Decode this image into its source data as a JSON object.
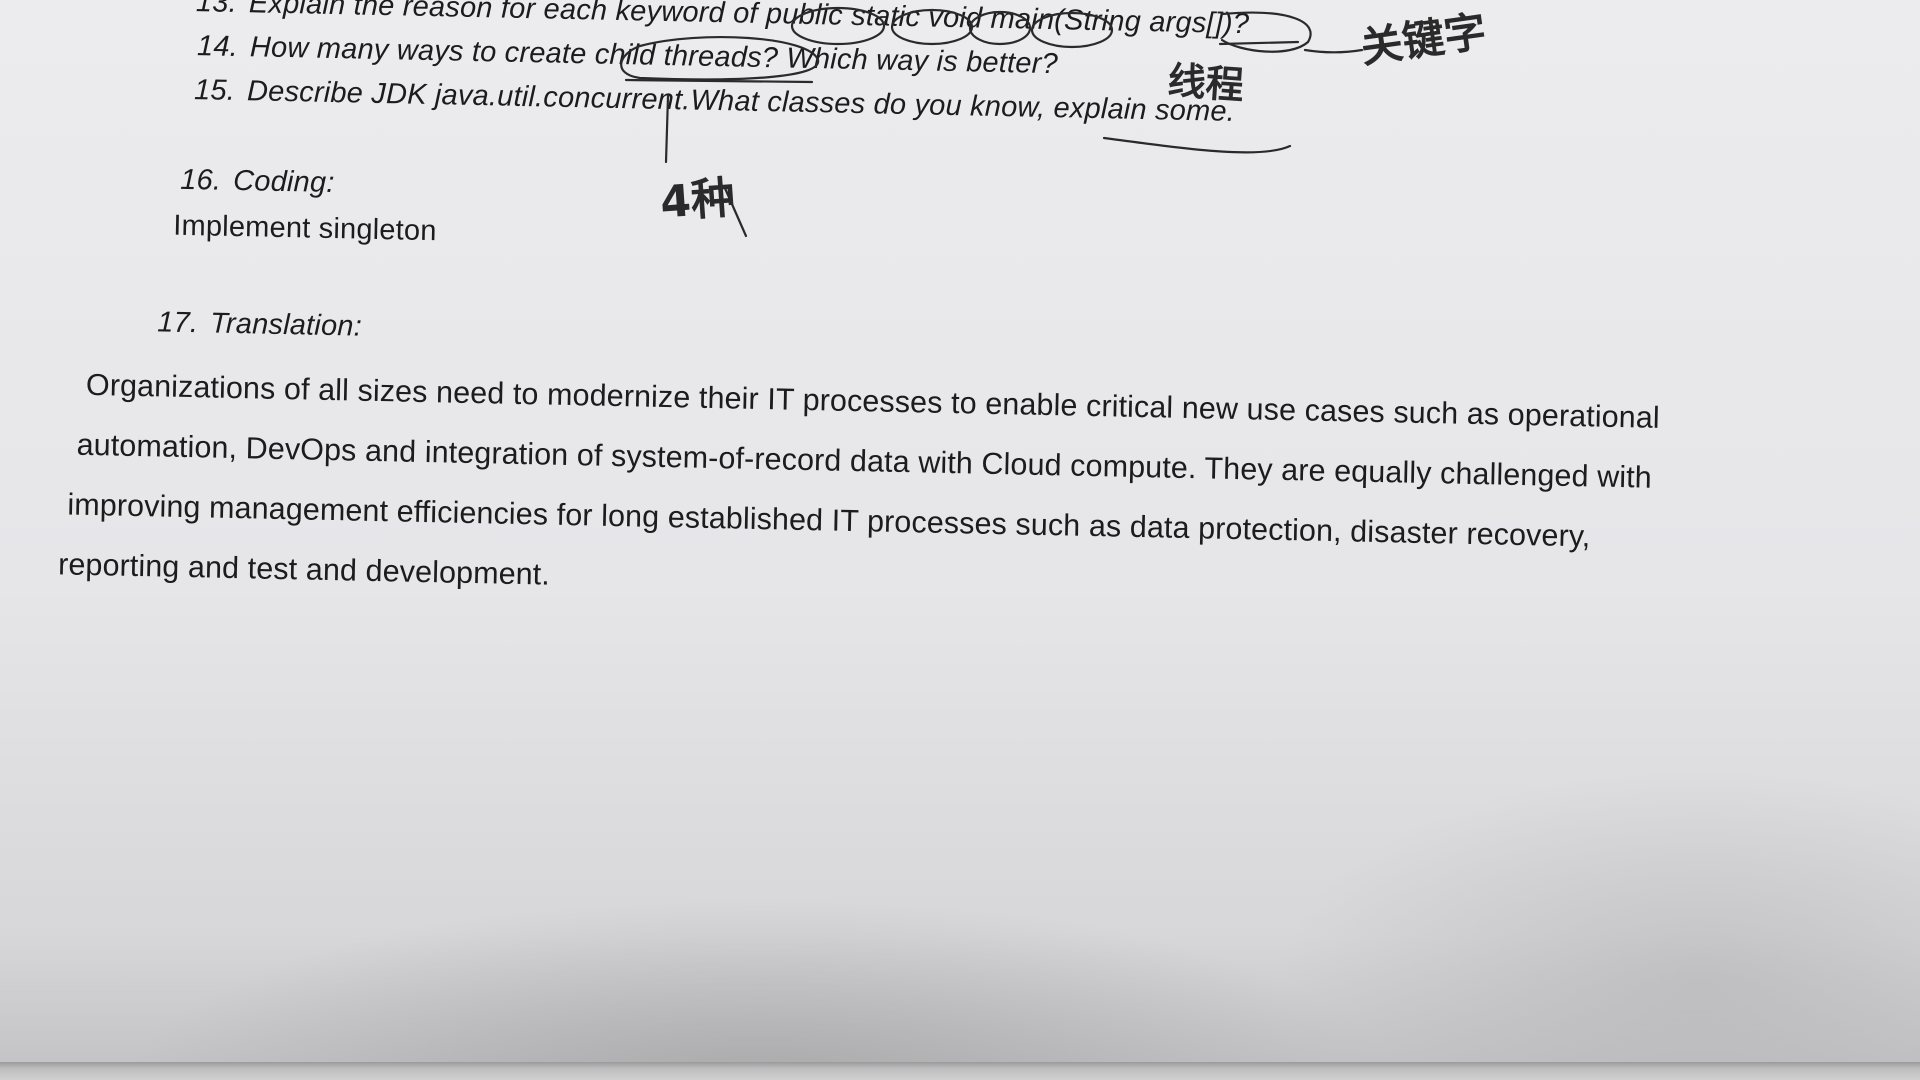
{
  "questions": [
    {
      "number": "13.",
      "text": "Explain the reason for each keyword of public static void main(String args[])?"
    },
    {
      "number": "14.",
      "text": "How many ways to create child threads? Which way is better?"
    },
    {
      "number": "15.",
      "text": "Describe JDK java.util.concurrent.What classes do you know, explain some."
    },
    {
      "number": "16.",
      "text": "Coding:",
      "subtext": "Implement singleton"
    },
    {
      "number": "17.",
      "text": "Translation:"
    }
  ],
  "translation_paragraph": [
    "Organizations of all sizes need to modernize their IT processes to enable critical new use cases such as operational",
    "automation, DevOps and integration of system-of-record data with Cloud compute. They are equally challenged with",
    "improving management efficiencies for long established IT processes such as data protection, disaster recovery,",
    "reporting and test and development."
  ],
  "handwriting": {
    "note_keyword": "关键字",
    "note_threads": "线程",
    "note_count": "4种"
  }
}
